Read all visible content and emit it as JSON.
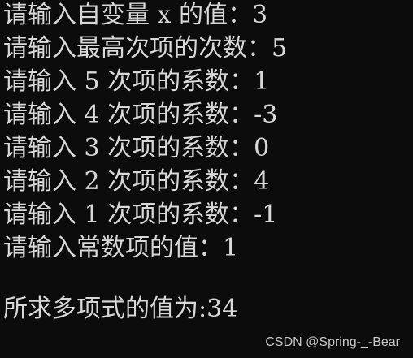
{
  "console": {
    "lines": [
      "请输入自变量 x 的值：3",
      "请输入最高次项的次数：5",
      "请输入 5 次项的系数：1",
      "请输入 4 次项的系数：-3",
      "请输入 3 次项的系数：0",
      "请输入 2 次项的系数：4",
      "请输入 1 次项的系数：-1",
      "请输入常数项的值：1",
      "",
      "所求多项式的值为:34"
    ],
    "text_color": "#d8d8d8",
    "background_color": "#0c0c0c"
  },
  "watermark": {
    "text": "CSDN @Spring-_-Bear"
  }
}
